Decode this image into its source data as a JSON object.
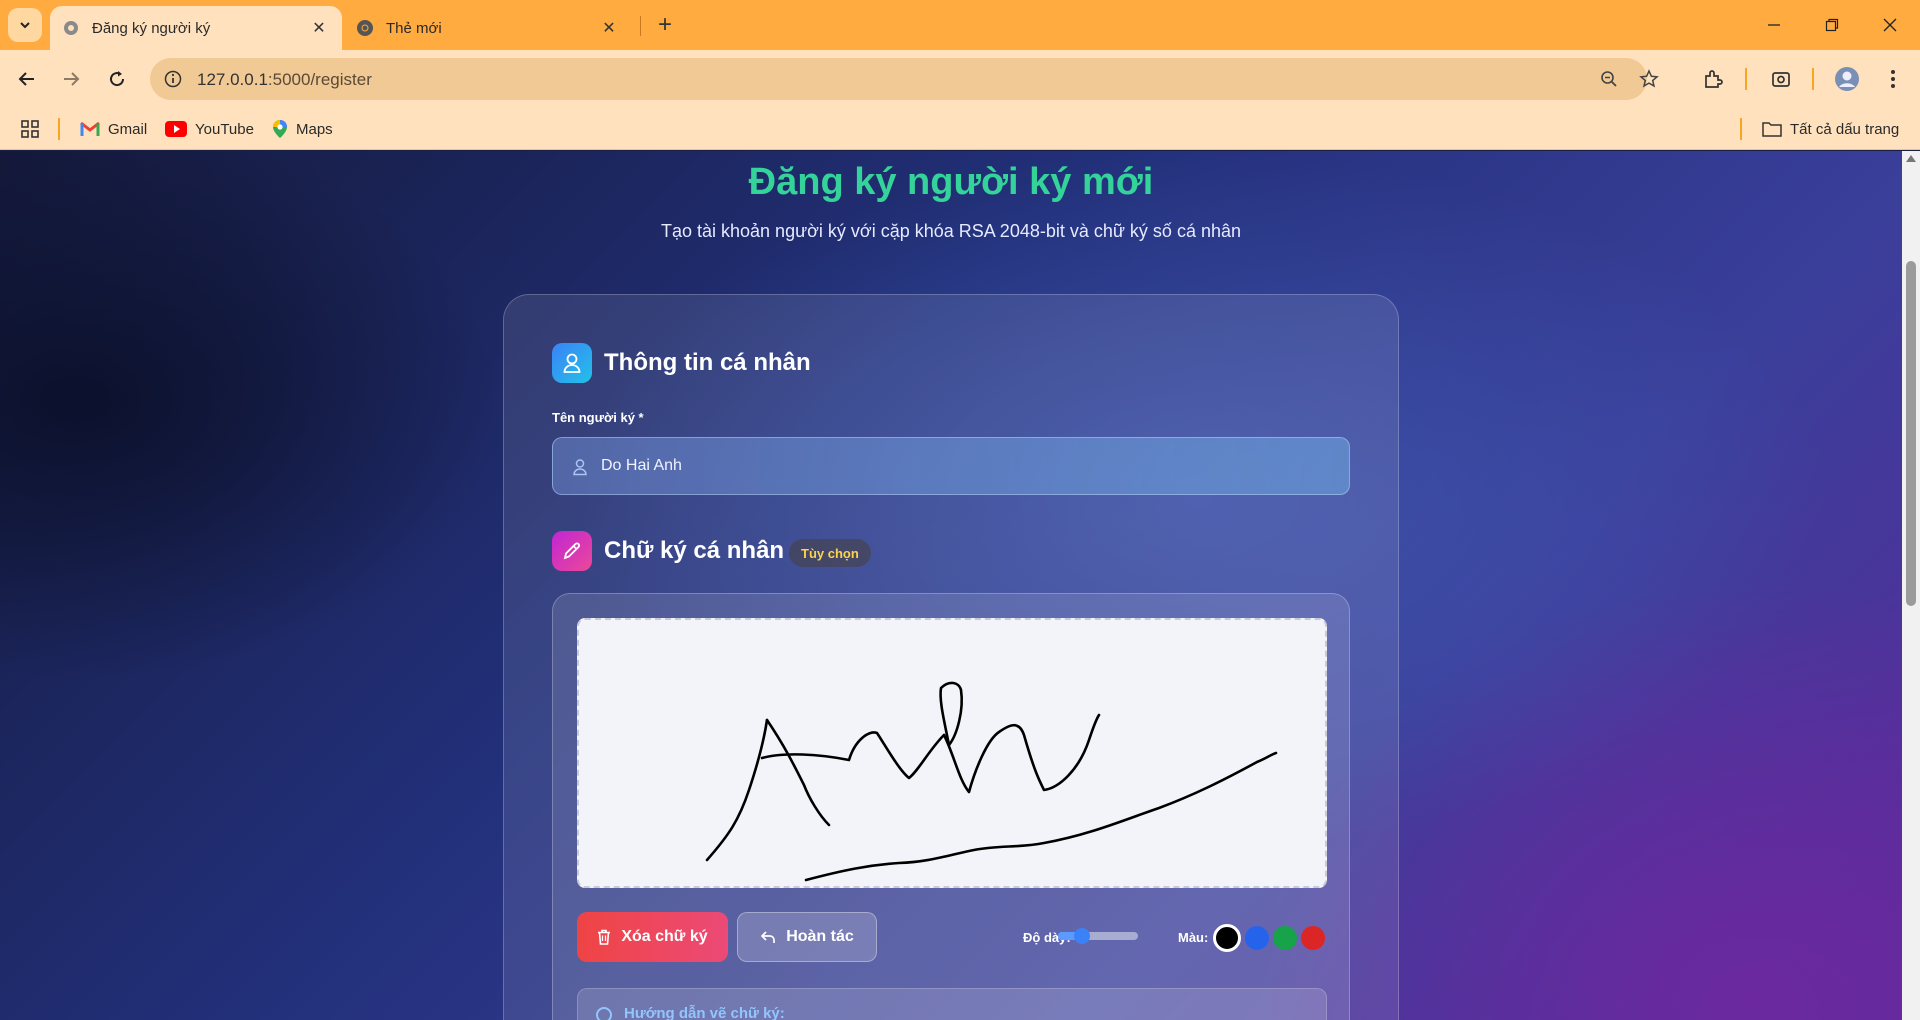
{
  "browser": {
    "tabs": [
      {
        "label": "Đăng ký người ký",
        "active": true
      },
      {
        "label": "Thẻ mới",
        "active": false
      }
    ],
    "url_host": "127.0.0.1",
    "url_path": ":5000/register",
    "bookmarks": [
      {
        "label": "Gmail",
        "icon": "gmail-icon"
      },
      {
        "label": "YouTube",
        "icon": "youtube-icon"
      },
      {
        "label": "Maps",
        "icon": "maps-icon"
      }
    ],
    "all_bookmarks_label": "Tất cả dấu trang"
  },
  "page": {
    "title": "Đăng ký người ký mới",
    "subtitle": "Tạo tài khoản người ký với cặp khóa RSA 2048-bit và chữ ký số cá nhân"
  },
  "personal_info": {
    "section_title": "Thông tin cá nhân",
    "name_label": "Tên người ký *",
    "name_value": "Do Hai Anh"
  },
  "signature": {
    "section_title": "Chữ ký cá nhân",
    "optional_badge": "Tùy chọn",
    "clear_label": "Xóa chữ ký",
    "undo_label": "Hoàn tác",
    "thickness_label": "Độ dày:",
    "thickness_level": 0.3,
    "color_label": "Màu:",
    "colors": [
      "#000000",
      "#2563eb",
      "#16a34a",
      "#dc2626"
    ],
    "selected_color": "#000000",
    "guide_title": "Hướng dẫn vẽ chữ ký:"
  },
  "colors": {
    "title_accent": "#34d399",
    "tab_bar": "#ffab40",
    "badge_text": "#fcd34d"
  }
}
